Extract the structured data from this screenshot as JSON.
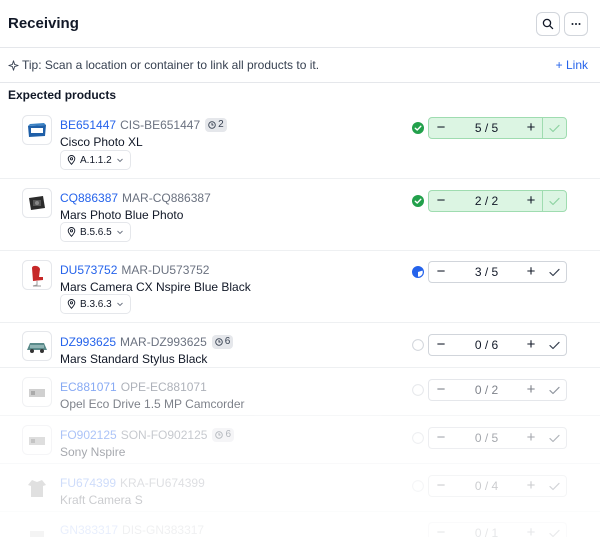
{
  "header": {
    "title": "Receiving",
    "search_icon": "search-icon",
    "more_icon": "more-icon"
  },
  "tip": {
    "text": "Tip: Scan a location or container to link all products to it.",
    "link_label": "+ Link"
  },
  "section_title": "Expected products",
  "rows": [
    {
      "code": "BE651447",
      "sku": "CIS-BE651447",
      "badge": "2",
      "name": "Cisco Photo XL",
      "location": "A.1.1.2",
      "qty": "5 / 5",
      "status": "complete"
    },
    {
      "code": "CQ886387",
      "sku": "MAR-CQ886387",
      "badge": "",
      "name": "Mars Photo Blue Photo",
      "location": "B.5.6.5",
      "qty": "2 / 2",
      "status": "complete"
    },
    {
      "code": "DU573752",
      "sku": "MAR-DU573752",
      "badge": "",
      "name": "Mars Camera CX Nspire Blue Black",
      "location": "B.3.6.3",
      "qty": "3 / 5",
      "status": "partial"
    },
    {
      "code": "DZ993625",
      "sku": "MAR-DZ993625",
      "badge": "6",
      "name": "Mars Standard Stylus Black",
      "location": "",
      "qty": "0 / 6",
      "status": "empty"
    },
    {
      "code": "EC881071",
      "sku": "OPE-EC881071",
      "badge": "",
      "name": "Opel Eco Drive 1.5 MP Camcorder",
      "location": "",
      "qty": "0 / 2",
      "status": "empty"
    },
    {
      "code": "FO902125",
      "sku": "SON-FO902125",
      "badge": "6",
      "name": "Sony Nspire",
      "location": "",
      "qty": "0 / 5",
      "status": "empty"
    },
    {
      "code": "FU674399",
      "sku": "KRA-FU674399",
      "badge": "",
      "name": "Kraft Camera S",
      "location": "",
      "qty": "0 / 4",
      "status": "empty"
    },
    {
      "code": "GN383317",
      "sku": "DIS-GN383317",
      "badge": "",
      "name": "",
      "location": "",
      "qty": "0 / 1",
      "status": "empty"
    }
  ],
  "colors": {
    "accent": "#2563eb",
    "success": "#22a04b",
    "success_bg": "#dcf5e3",
    "border": "#e5e7eb"
  }
}
